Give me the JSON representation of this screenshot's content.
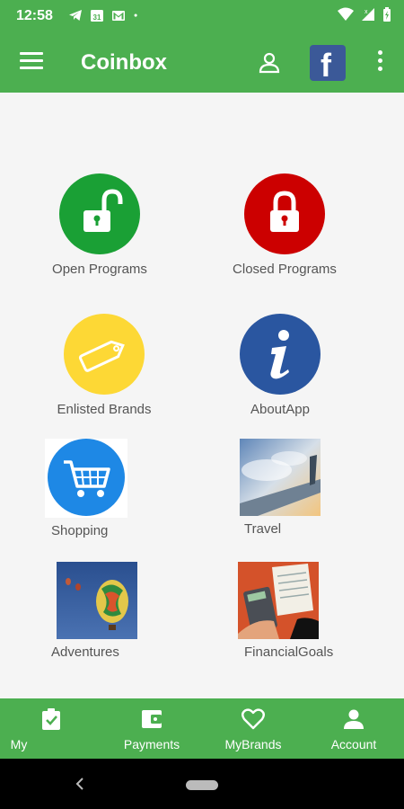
{
  "status_bar": {
    "time": "12:58",
    "left_icons": [
      "telegram-icon",
      "calendar-icon",
      "gmail-icon",
      "dot-icon"
    ],
    "calendar_day": "31",
    "right_icons": [
      "wifi-icon",
      "signal-icon",
      "battery-icon"
    ]
  },
  "app_bar": {
    "title": "Coinbox",
    "facebook_letter": "f",
    "menu_icon": "hamburger-icon",
    "person_icon": "person-icon",
    "more_icon": "more-vert-icon"
  },
  "tiles": [
    {
      "label": "Open Programs",
      "icon": "unlock-icon",
      "color": "#1aa035"
    },
    {
      "label": "Closed Programs",
      "icon": "lock-icon",
      "color": "#cc0000"
    },
    {
      "label": "Enlisted Brands",
      "icon": "tag-icon",
      "color": "#fdd835"
    },
    {
      "label": "AboutApp",
      "icon": "info-icon",
      "color": "#2a56a0"
    },
    {
      "label": "Shopping",
      "icon": "cart-icon",
      "color": "#1e88e5"
    },
    {
      "label": "Travel",
      "icon": "airplane-photo",
      "color": "#8fa7c4"
    },
    {
      "label": "Adventures",
      "icon": "balloon-photo",
      "color": "#2e5a9a"
    },
    {
      "label": "FinancialGoals",
      "icon": "calculator-photo",
      "color": "#d4522a"
    }
  ],
  "bottom_nav": [
    {
      "label": "My",
      "icon": "clipboard-check-icon"
    },
    {
      "label": "Payments",
      "icon": "wallet-icon"
    },
    {
      "label": "MyBrands",
      "icon": "heart-icon"
    },
    {
      "label": "Account",
      "icon": "account-icon"
    }
  ],
  "colors": {
    "primary": "#4caf50",
    "background": "#f5f5f5",
    "facebook": "#3b5998"
  }
}
